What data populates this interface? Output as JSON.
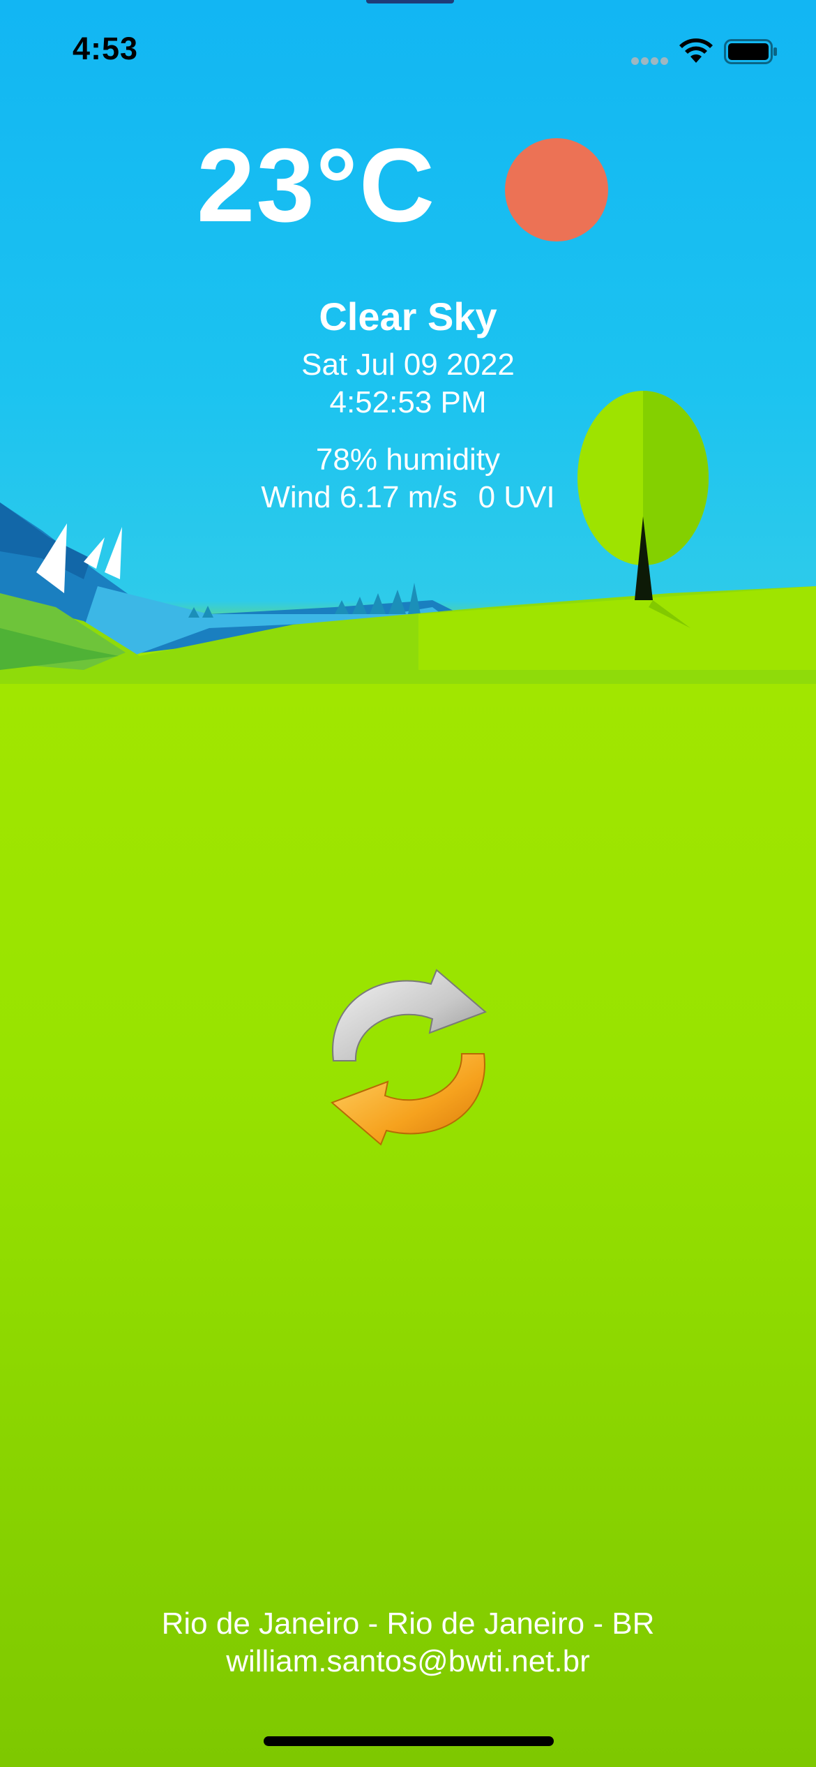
{
  "status_bar": {
    "time": "4:53"
  },
  "weather": {
    "temperature": "23°C",
    "condition": "Clear Sky",
    "date": "Sat Jul 09 2022",
    "time": "4:52:53 PM",
    "humidity": "78% humidity",
    "wind": "Wind 6.17 m/s",
    "uvi": "0 UVI",
    "icon": "sun-icon",
    "sun_color": "#ec7255"
  },
  "refresh": {
    "icon": "refresh-icon"
  },
  "footer": {
    "location": "Rio de Janeiro - Rio de Janeiro - BR",
    "email": "william.santos@bwti.net.br"
  },
  "colors": {
    "sky": "#1cc3f0",
    "grass": "#98e300",
    "text": "#ffffff"
  }
}
